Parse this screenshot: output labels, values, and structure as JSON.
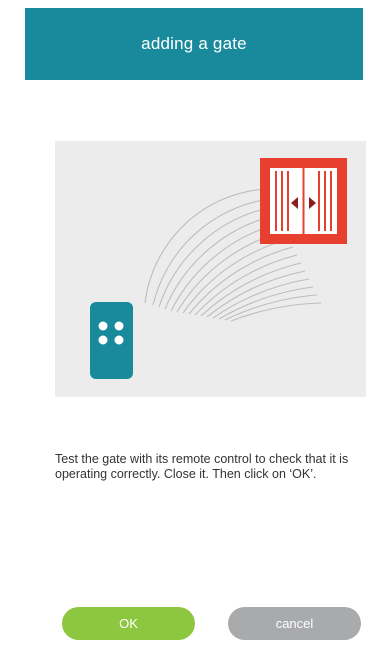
{
  "header": {
    "title": "adding a gate"
  },
  "illustration": {
    "remote_icon": "remote-control-icon",
    "gate_icon": "sliding-gate-icon",
    "signal_icon": "signal-waves-icon"
  },
  "instructions": {
    "text": "Test the gate with its remote control to check that it is operating correctly. Close it. Then click on ‘OK’."
  },
  "buttons": {
    "ok_label": "OK",
    "cancel_label": "cancel"
  },
  "colors": {
    "header": "#198a9c",
    "remote": "#198a9c",
    "gate": "#e8402f",
    "ok": "#8dc63f",
    "cancel": "#a9aaac"
  }
}
